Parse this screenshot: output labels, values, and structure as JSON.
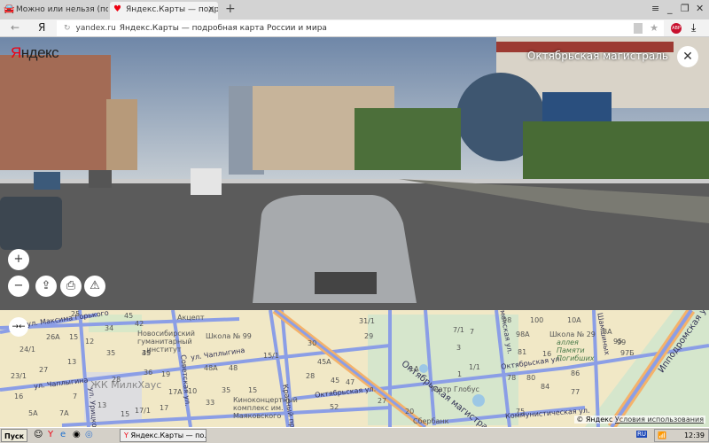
{
  "browser": {
    "tabs": [
      {
        "label": "Можно или нельзя (поворо",
        "icon": "car-icon",
        "active": false
      },
      {
        "label": "Яндекс.Карты — подробн",
        "icon": "map-pin-icon",
        "active": true
      }
    ],
    "new_tab": "+",
    "window": {
      "menu": "≡",
      "minimize": "_",
      "restore": "❐",
      "close": "✕"
    },
    "back": "←",
    "yandex_button": "Я",
    "reload": "↻",
    "address_domain": "yandex.ru",
    "address_title": "Яндекс.Карты — подробная карта России и мира",
    "star": "★",
    "abp": "ABP",
    "download": "⤓"
  },
  "panorama": {
    "logo_red": "Я",
    "logo_rest": "ндекс",
    "street_name": "Октябрьская магистраль",
    "close": "✕",
    "controls": {
      "zoom_in": "+",
      "zoom_out": "−",
      "share": "⇪",
      "print": "⎙",
      "report": "⚠"
    }
  },
  "map": {
    "collapse": "→←",
    "streets": [
      "ул. Максима Горького",
      "ул. Чаплыгина",
      "ул. Чаплыгина",
      "ул. Урицкого",
      "Советская ул.",
      "Красный пр.",
      "Октябрьская ул.",
      "Октябрьская ул.",
      "Каменская ул.",
      "Октябрьская магистраль",
      "Коммунистическая ул.",
      "ул. Шамшиных",
      "Ипподромская ул."
    ],
    "pois": [
      "Акцепт",
      "Новосибирский гуманитарный институт",
      "Школа № 99",
      "ЖК МилкХаус",
      "Киноконцертный комплекс им. Маяковского",
      "Театр Глобус",
      "Сбербанк",
      "Школа № 29",
      "аллея Памяти Погибших"
    ],
    "houses": [
      "45",
      "25",
      "42",
      "34",
      "26А",
      "15",
      "12",
      "24/1",
      "35",
      "39",
      "45",
      "13",
      "27",
      "23/1",
      "28",
      "36",
      "19",
      "48А",
      "48",
      "15/1",
      "30",
      "45А",
      "28",
      "45",
      "47",
      "16",
      "7",
      "13",
      "17А",
      "10",
      "35",
      "15",
      "52",
      "5А",
      "7А",
      "17/1",
      "17",
      "33",
      "15",
      "31/1",
      "29",
      "7/1",
      "7",
      "3",
      "1А",
      "1/1",
      "1",
      "98",
      "100",
      "10А",
      "98А",
      "8А",
      "99",
      "95",
      "16",
      "81",
      "97Б",
      "78",
      "80",
      "86",
      "84",
      "77",
      "27",
      "20",
      "75"
    ],
    "copyright": "© Яндекс",
    "terms": "Условия использования"
  },
  "taskbar": {
    "start": "Пуск",
    "window_task": "Яндекс.Карты — по...",
    "lang": "RU",
    "clock": "12:39"
  }
}
